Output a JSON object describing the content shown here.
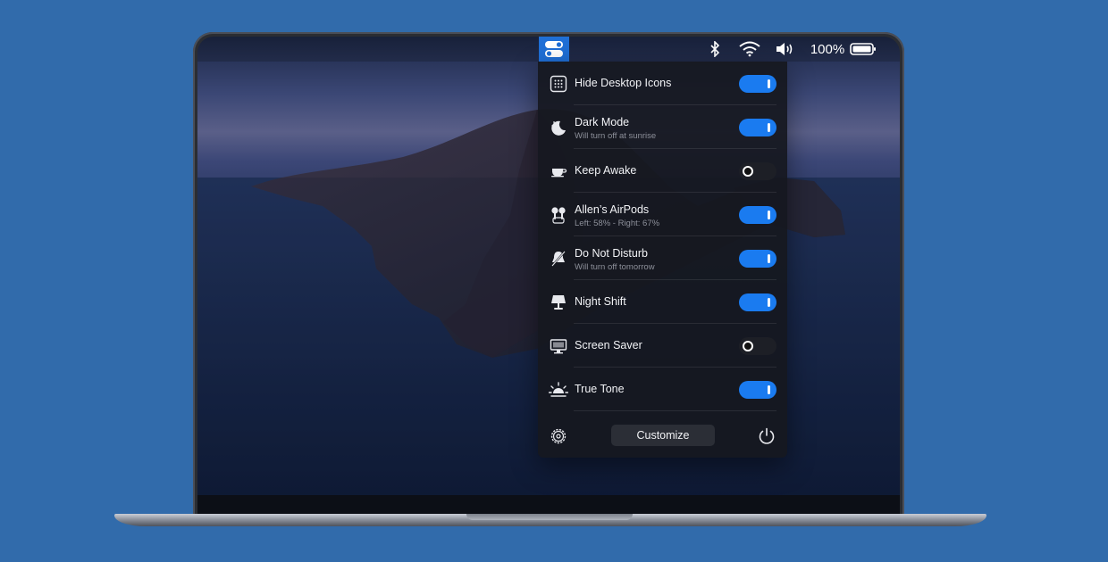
{
  "menubar": {
    "app_icon": "control-toggles-icon",
    "icons": [
      "bluetooth-icon",
      "wifi-icon",
      "volume-icon",
      "battery-icon"
    ],
    "battery_percent": "100%",
    "accent_color": "#1f6fd6"
  },
  "panel": {
    "items": [
      {
        "icon": "grid-icon",
        "title": "Hide Desktop Icons",
        "subtitle": "",
        "enabled": true
      },
      {
        "icon": "moon-icon",
        "title": "Dark Mode",
        "subtitle": "Will turn off at sunrise",
        "enabled": true
      },
      {
        "icon": "cup-icon",
        "title": "Keep Awake",
        "subtitle": "",
        "enabled": false
      },
      {
        "icon": "airpods-icon",
        "title": "Allen’s AirPods",
        "subtitle": "Left: 58% - Right: 67%",
        "enabled": true
      },
      {
        "icon": "do-not-disturb-icon",
        "title": "Do Not Disturb",
        "subtitle": "Will turn off tomorrow",
        "enabled": true
      },
      {
        "icon": "lamp-icon",
        "title": "Night Shift",
        "subtitle": "",
        "enabled": true
      },
      {
        "icon": "monitor-icon",
        "title": "Screen Saver",
        "subtitle": "",
        "enabled": false
      },
      {
        "icon": "sun-icon",
        "title": "True Tone",
        "subtitle": "",
        "enabled": true
      }
    ],
    "footer": {
      "settings_icon": "gear-icon",
      "customize_label": "Customize",
      "power_icon": "power-icon"
    },
    "toggle_on_color": "#1a7bf0"
  }
}
